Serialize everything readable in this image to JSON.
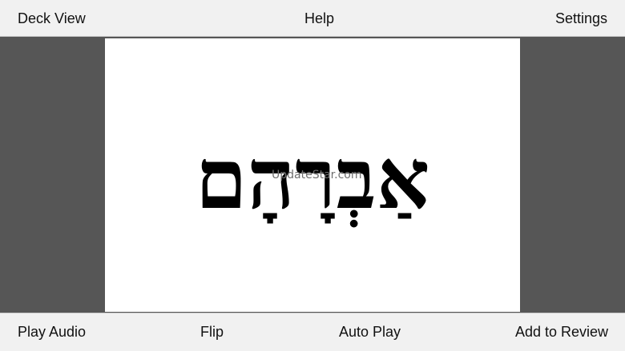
{
  "top_bar": {
    "deck_view": "Deck View",
    "help": "Help",
    "settings": "Settings"
  },
  "card": {
    "word": "אַבְרָהָם",
    "watermark": "UpdateStar.com"
  },
  "bottom_bar": {
    "play_audio": "Play Audio",
    "flip": "Flip",
    "auto_play": "Auto Play",
    "add_to_review": "Add to Review"
  },
  "colors": {
    "bar_background": "#f1f1f1",
    "page_background": "#565656",
    "card_background": "#ffffff",
    "text": "#111111"
  }
}
